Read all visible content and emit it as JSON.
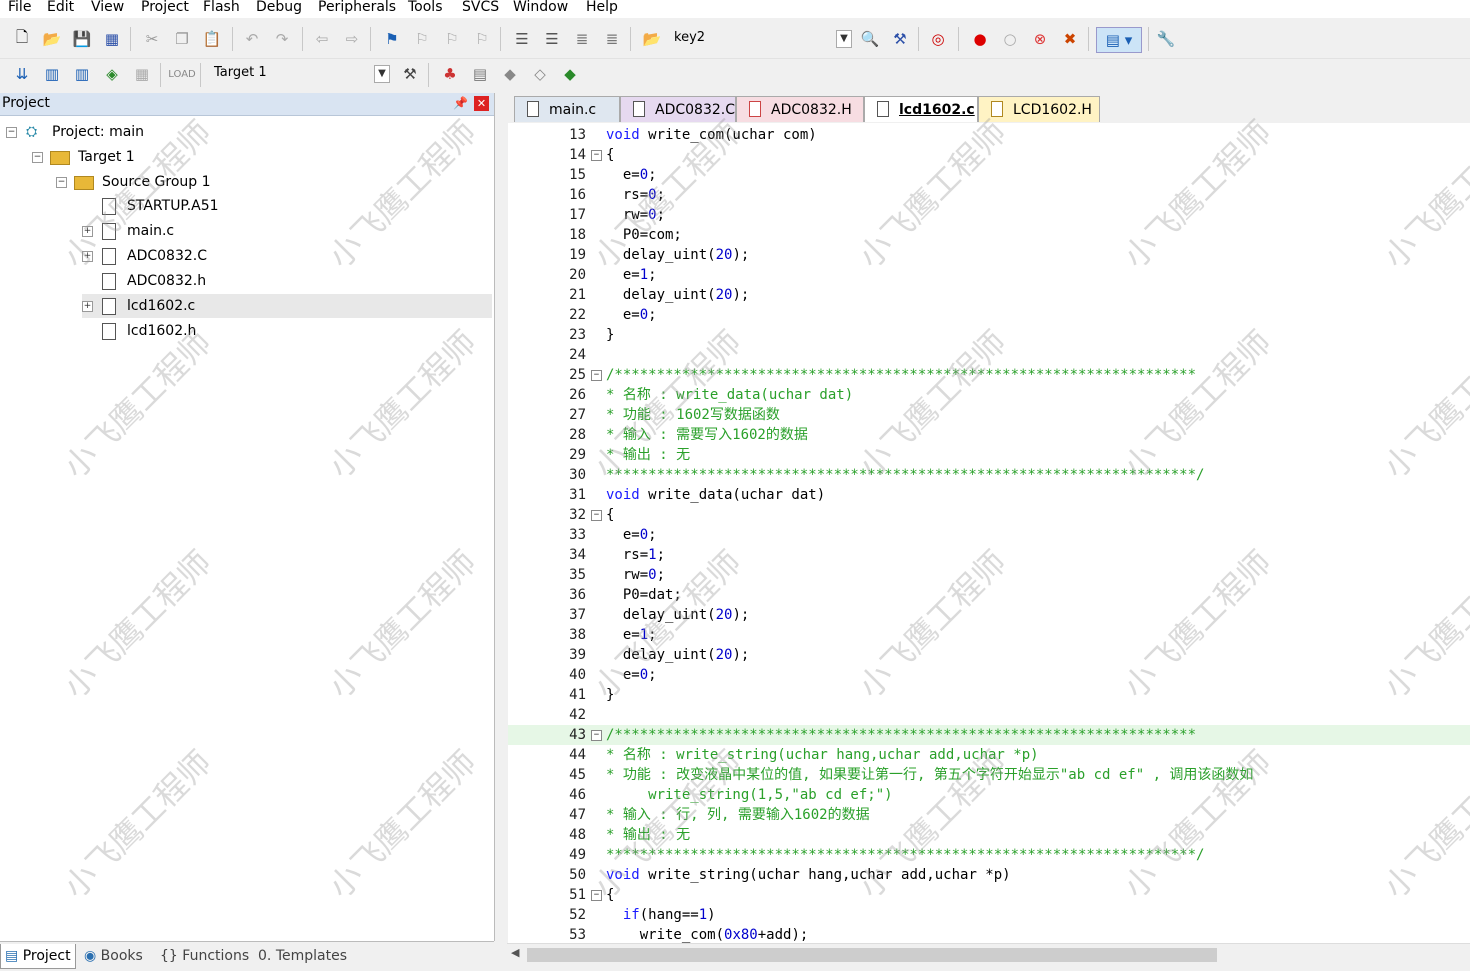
{
  "menu": [
    "File",
    "Edit",
    "View",
    "Project",
    "Flash",
    "Debug",
    "Peripherals",
    "Tools",
    "SVCS",
    "Window",
    "Help"
  ],
  "toolbar": {
    "find_combo": "key2",
    "target_combo": "Target 1"
  },
  "project_panel": {
    "title": "Project",
    "tree": [
      {
        "label": "Project: main"
      },
      {
        "label": "Target 1"
      },
      {
        "label": "Source Group 1"
      },
      {
        "label": "STARTUP.A51"
      },
      {
        "label": "main.c"
      },
      {
        "label": "ADC0832.C"
      },
      {
        "label": "ADC0832.h"
      },
      {
        "label": "lcd1602.c"
      },
      {
        "label": "lcd1602.h"
      }
    ],
    "bottom_tabs": [
      "Project",
      "Books",
      "Functions",
      "Templates"
    ]
  },
  "editor_tabs": [
    "main.c",
    "ADC0832.C",
    "ADC0832.H",
    "lcd1602.c",
    "LCD1602.H"
  ],
  "code": [
    {
      "n": "13",
      "t": "void write_com(uchar com)"
    },
    {
      "n": "14",
      "t": "{"
    },
    {
      "n": "15",
      "t": "  e=0;"
    },
    {
      "n": "16",
      "t": "  rs=0;"
    },
    {
      "n": "17",
      "t": "  rw=0;"
    },
    {
      "n": "18",
      "t": "  P0=com;"
    },
    {
      "n": "19",
      "t": "  delay_uint(20);"
    },
    {
      "n": "20",
      "t": "  e=1;"
    },
    {
      "n": "21",
      "t": "  delay_uint(20);"
    },
    {
      "n": "22",
      "t": "  e=0;"
    },
    {
      "n": "23",
      "t": "}"
    },
    {
      "n": "24",
      "t": ""
    },
    {
      "n": "25",
      "t": "/*********************************************************************"
    },
    {
      "n": "26",
      "t": "* 名称 : write_data(uchar dat)"
    },
    {
      "n": "27",
      "t": "* 功能 : 1602写数据函数"
    },
    {
      "n": "28",
      "t": "* 输入 : 需要写入1602的数据"
    },
    {
      "n": "29",
      "t": "* 输出 : 无"
    },
    {
      "n": "30",
      "t": "**********************************************************************/"
    },
    {
      "n": "31",
      "t": "void write_data(uchar dat)"
    },
    {
      "n": "32",
      "t": "{"
    },
    {
      "n": "33",
      "t": "  e=0;"
    },
    {
      "n": "34",
      "t": "  rs=1;"
    },
    {
      "n": "35",
      "t": "  rw=0;"
    },
    {
      "n": "36",
      "t": "  P0=dat;"
    },
    {
      "n": "37",
      "t": "  delay_uint(20);"
    },
    {
      "n": "38",
      "t": "  e=1;"
    },
    {
      "n": "39",
      "t": "  delay_uint(20);"
    },
    {
      "n": "40",
      "t": "  e=0;"
    },
    {
      "n": "41",
      "t": "}"
    },
    {
      "n": "42",
      "t": ""
    },
    {
      "n": "43",
      "t": "/*********************************************************************"
    },
    {
      "n": "44",
      "t": "* 名称 : write_string(uchar hang,uchar add,uchar *p)"
    },
    {
      "n": "45",
      "t": "* 功能 : 改变液晶中某位的值, 如果要让第一行, 第五个字符开始显示\"ab cd ef\" , 调用该函数如"
    },
    {
      "n": "46",
      "t": "     write_string(1,5,\"ab cd ef;\")"
    },
    {
      "n": "47",
      "t": "* 输入 : 行, 列, 需要输入1602的数据"
    },
    {
      "n": "48",
      "t": "* 输出 : 无"
    },
    {
      "n": "49",
      "t": "**********************************************************************/"
    },
    {
      "n": "50",
      "t": "void write_string(uchar hang,uchar add,uchar *p)"
    },
    {
      "n": "51",
      "t": "{"
    },
    {
      "n": "52",
      "t": "  if(hang==1)"
    },
    {
      "n": "53",
      "t": "    write_com(0x80+add);"
    }
  ],
  "watermark": "小飞鹰工程师"
}
